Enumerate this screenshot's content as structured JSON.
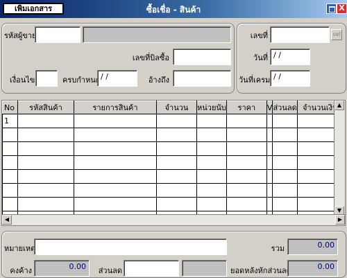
{
  "window": {
    "doc_button": "เพิ่มเอกสาร",
    "title": "ซื้อเชื่อ - สินค้า",
    "close_glyph": "X"
  },
  "header": {
    "supplier_code_label": "รหัสผู้ขาย",
    "supplier_code": "",
    "supplier_name": "",
    "invoice_no_label": "เลขที่บิลซื้อ",
    "invoice_no": "",
    "term_label": "เงื่อนไข",
    "term": "",
    "due_label": "ครบกำหนด",
    "due": " / /",
    "ref_label": "อ้างถึง",
    "ref": "",
    "doc_no_label": "เลขที่",
    "doc_no": "",
    "doc_no_btn": "sel",
    "date_label": "วันที่",
    "date": " / /",
    "add_date_label": "วันที่เครม",
    "add_date": " / /"
  },
  "grid": {
    "columns": [
      "No",
      "รหัสสินค้า",
      "รายการสินค้า",
      "จำนวน",
      "หน่วยนับ",
      "ราคา",
      "V",
      "ส่วนลด",
      "จำนวนเงิน"
    ],
    "rows": [
      [
        "1",
        "",
        "",
        "",
        "",
        "",
        "",
        "",
        ""
      ],
      [
        "",
        "",
        "",
        "",
        "",
        "",
        "",
        "",
        ""
      ],
      [
        "",
        "",
        "",
        "",
        "",
        "",
        "",
        "",
        ""
      ],
      [
        "",
        "",
        "",
        "",
        "",
        "",
        "",
        "",
        ""
      ],
      [
        "",
        "",
        "",
        "",
        "",
        "",
        "",
        "",
        ""
      ],
      [
        "",
        "",
        "",
        "",
        "",
        "",
        "",
        "",
        ""
      ],
      [
        "",
        "",
        "",
        "",
        "",
        "",
        "",
        "",
        ""
      ],
      [
        "",
        "",
        "",
        "",
        "",
        "",
        "",
        "",
        ""
      ]
    ]
  },
  "footer": {
    "note_label": "หมายเหตุ",
    "note": "",
    "total_label": "รวม",
    "total": "0.00",
    "balance_label": "คงค้าง",
    "balance": "0.00",
    "discount_label": "ส่วนลด",
    "discount": "",
    "discount_amount": "",
    "net_label": "ยอดหลังหักส่วนลด",
    "net": "0.00"
  }
}
